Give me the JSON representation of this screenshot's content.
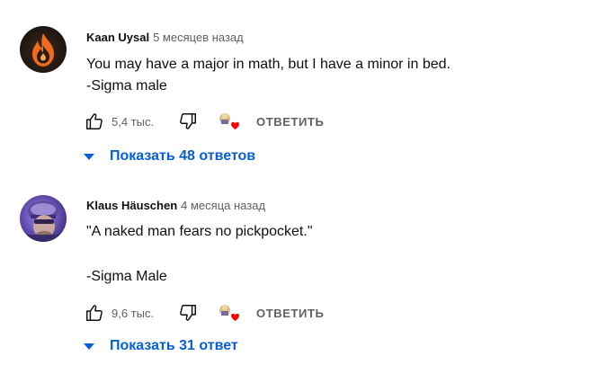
{
  "comments": [
    {
      "author": "Kaan Uysal",
      "time": "5 месяцев назад",
      "lines": [
        "You may have a major in math, but I have a minor in bed.",
        "-Sigma male"
      ],
      "likes": "5,4 тыс.",
      "reply_label": "ОТВЕТИТЬ",
      "show_replies": "Показать 48 ответов",
      "avatar_icon": "fire-icon"
    },
    {
      "author": "Klaus Häuschen",
      "time": "4 месяца назад",
      "lines": [
        "\"A naked man fears no pickpocket.\"",
        "-Sigma Male"
      ],
      "likes": "9,6 тыс.",
      "reply_label": "ОТВЕТИТЬ",
      "show_replies": "Показать 31 ответ",
      "avatar_icon": "soldier-photo"
    }
  ],
  "colors": {
    "link_blue": "#065fd4",
    "secondary_text": "#606060",
    "primary_text": "#0f0f0f",
    "heart_red": "#ff0000"
  },
  "icons": {
    "like": "thumbs-up-icon",
    "dislike": "thumbs-down-icon",
    "creator_heart": "creator-heart-icon",
    "expand": "caret-down-icon"
  }
}
